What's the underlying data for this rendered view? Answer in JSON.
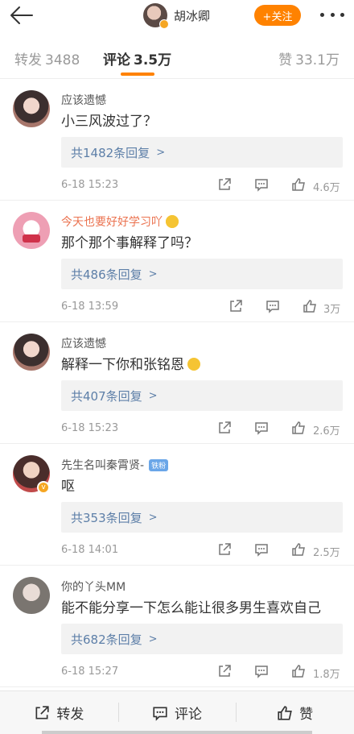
{
  "header": {
    "username": "胡冰卿",
    "follow_label": "+关注"
  },
  "tabs": {
    "repost_label": "转发",
    "repost_count": "3488",
    "comment_label": "评论",
    "comment_count": "3.5万",
    "like_label": "赞",
    "like_count": "33.1万"
  },
  "comments": [
    {
      "user": "应该遗憾",
      "text": "小三风波过了？",
      "replies": "共1482条回复",
      "time": "6-18 15:23",
      "likes": "4.6万"
    },
    {
      "user": "今天也要好好学习吖",
      "text": "那个那个事解释了吗？",
      "replies": "共486条回复",
      "time": "6-18 13:59",
      "likes": "3万"
    },
    {
      "user": "应该遗憾",
      "text": "解释一下你和张铭恩",
      "replies": "共407条回复",
      "time": "6-18 15:23",
      "likes": "2.6万"
    },
    {
      "user": "先生名叫秦霄贤-",
      "badge": "铁粉",
      "text": "呕",
      "replies": "共353条回复",
      "time": "6-18 14:01",
      "likes": "2.5万"
    },
    {
      "user": "你的丫头MM",
      "text": "能不能分享一下怎么能让很多男生喜欢自己",
      "replies": "共682条回复",
      "time": "6-18 15:27",
      "likes": "1.8万"
    }
  ],
  "bottom_bar": {
    "repost_label": "转发",
    "comment_label": "评论",
    "like_label": "赞"
  },
  "colors": {
    "accent": "#ff8200",
    "link": "#5d7fa8",
    "orange_name": "#eb7350"
  }
}
